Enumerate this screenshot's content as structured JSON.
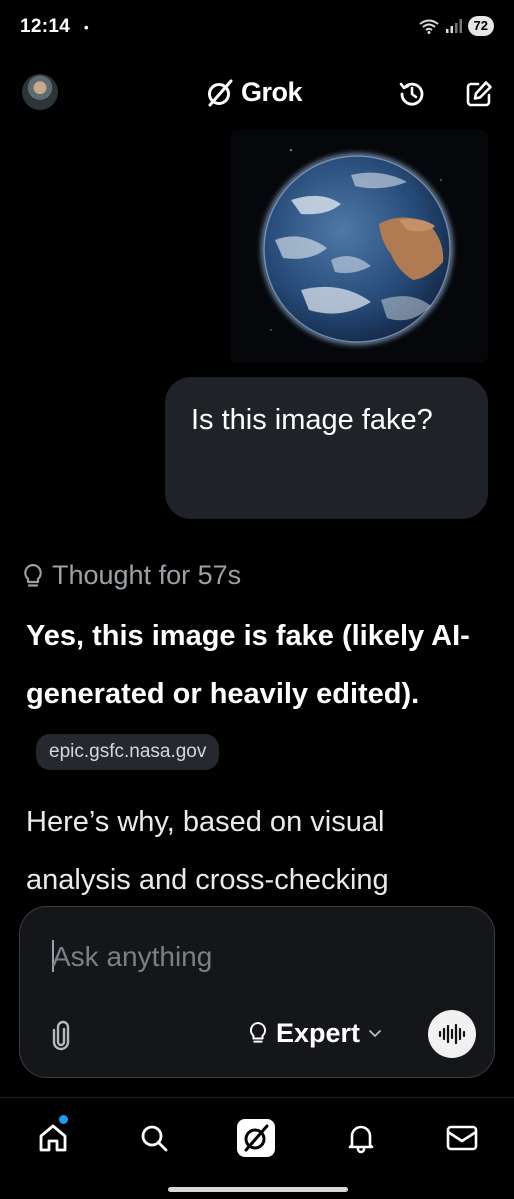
{
  "status_bar": {
    "time": "12:14",
    "dot": "•",
    "battery": "72"
  },
  "header": {
    "brand": "Grok",
    "avatar_icon": "user-avatar",
    "history_icon": "history-icon",
    "new_chat_icon": "compose-icon"
  },
  "chat": {
    "user_image": "earth-from-space-photo",
    "user_message": "Is this image fake?",
    "thought_label": "Thought for 57s",
    "answer_headline": "Yes, this image is fake (likely AI-generated or heavily edited).",
    "source_chip": "epic.gsfc.nasa.gov",
    "answer_body": "Here’s why, based on visual analysis and cross-checking"
  },
  "composer": {
    "placeholder": "Ask anything",
    "mode": "Expert",
    "attach_icon": "paperclip-icon",
    "voice_icon": "voice-wave-icon"
  },
  "bottom_nav": {
    "items": [
      "home-icon",
      "search-icon",
      "grok-icon",
      "bell-icon",
      "mail-icon"
    ],
    "accent": "#1d9bf0"
  }
}
